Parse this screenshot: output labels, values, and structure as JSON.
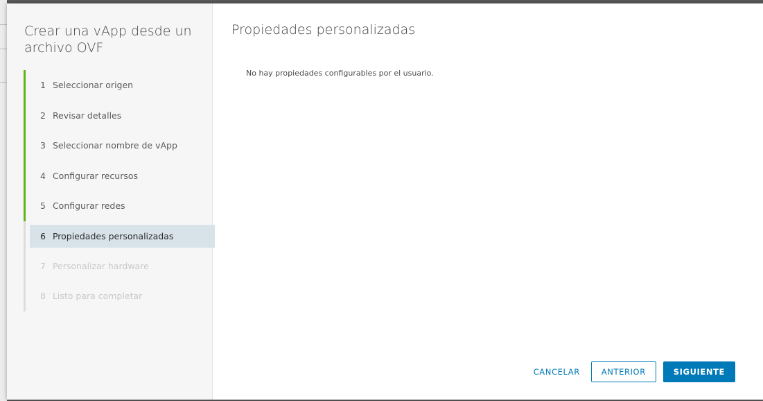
{
  "wizard": {
    "title": "Crear una vApp desde un archivo OVF",
    "steps": [
      {
        "num": "1",
        "label": "Seleccionar origen",
        "state": "done"
      },
      {
        "num": "2",
        "label": "Revisar detalles",
        "state": "done"
      },
      {
        "num": "3",
        "label": "Seleccionar nombre de vApp",
        "state": "done"
      },
      {
        "num": "4",
        "label": "Configurar recursos",
        "state": "done"
      },
      {
        "num": "5",
        "label": "Configurar redes",
        "state": "done"
      },
      {
        "num": "6",
        "label": "Propiedades personalizadas",
        "state": "active"
      },
      {
        "num": "7",
        "label": "Personalizar hardware",
        "state": "disabled"
      },
      {
        "num": "8",
        "label": "Listo para completar",
        "state": "disabled"
      }
    ]
  },
  "content": {
    "title": "Propiedades personalizadas",
    "message": "No hay propiedades configurables por el usuario."
  },
  "footer": {
    "cancel_label": "CANCELAR",
    "back_label": "ANTERIOR",
    "next_label": "SIGUIENTE"
  },
  "colors": {
    "accent": "#0079b8",
    "completed_step": "#60b515",
    "active_step_bg": "#d8e3e9"
  }
}
